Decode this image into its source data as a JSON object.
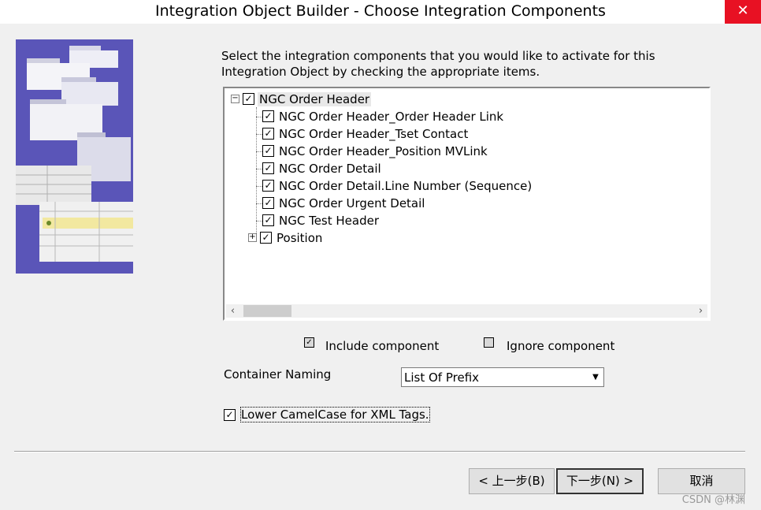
{
  "window": {
    "title": "Integration Object Builder - Choose Integration Components",
    "close_glyph": "✕"
  },
  "instructions": "Select the integration components that you would like to activate for this Integration Object by checking the appropriate items.",
  "tree": {
    "root": {
      "label": "NGC Order Header",
      "checked": true,
      "expander": "−"
    },
    "children": [
      {
        "label": "NGC Order Header_Order Header Link",
        "checked": true
      },
      {
        "label": "NGC Order Header_Tset Contact",
        "checked": true
      },
      {
        "label": "NGC Order Header_Position MVLink",
        "checked": true
      },
      {
        "label": "NGC Order Detail",
        "checked": true
      },
      {
        "label": "NGC Order Detail.Line Number (Sequence)",
        "checked": true
      },
      {
        "label": "NGC Order Urgent Detail",
        "checked": true
      },
      {
        "label": "NGC Test Header",
        "checked": true
      },
      {
        "label": "Position",
        "checked": true,
        "expander": "+"
      }
    ],
    "scroll_left": "‹",
    "scroll_right": "›"
  },
  "legend": {
    "include_label": "Include component",
    "ignore_label": "Ignore component"
  },
  "container_naming": {
    "label": "Container Naming",
    "value": "List Of Prefix",
    "arrow": "▼"
  },
  "camelcase": {
    "label": "Lower CamelCase for XML Tags.",
    "checked": true
  },
  "check_glyph": "✓",
  "buttons": {
    "back": "< 上一步(B)",
    "next": "下一步(N) >",
    "cancel": "取消"
  },
  "watermark": "CSDN @林渊",
  "colors": {
    "panel_bg": "#f0f0f0",
    "image_bg": "#5a55b8",
    "close_red": "#e81123"
  }
}
